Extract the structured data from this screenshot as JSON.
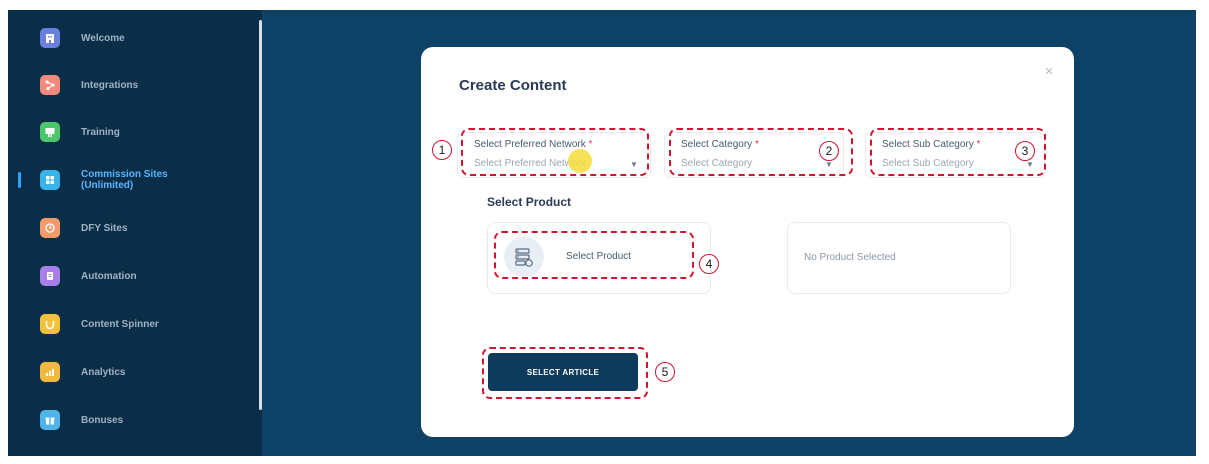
{
  "sidebar": {
    "items": [
      {
        "label": "Welcome",
        "icon": "building-icon",
        "color": "#6b7fe0",
        "active": false
      },
      {
        "label": "Integrations",
        "icon": "integrations-icon",
        "color": "#f08a7a",
        "active": false
      },
      {
        "label": "Training",
        "icon": "training-icon",
        "color": "#4cc66a",
        "active": false
      },
      {
        "label": "Commission Sites\n(Unlimited)",
        "icon": "commission-icon",
        "color": "#36b3e8",
        "active": true
      },
      {
        "label": "DFY Sites",
        "icon": "dfy-icon",
        "color": "#f59a6b",
        "active": false
      },
      {
        "label": "Automation",
        "icon": "automation-icon",
        "color": "#a77fe8",
        "active": false
      },
      {
        "label": "Content Spinner",
        "icon": "spinner-icon",
        "color": "#f4c13d",
        "active": false
      },
      {
        "label": "Analytics",
        "icon": "analytics-icon",
        "color": "#f2b941",
        "active": false
      },
      {
        "label": "Bonuses",
        "icon": "bonuses-icon",
        "color": "#4fb5e8",
        "active": false
      }
    ]
  },
  "modal": {
    "title": "Create Content",
    "close": "×",
    "fields": {
      "network": {
        "label": "Select Preferred Network",
        "required": "*",
        "value": "Select Preferred Network"
      },
      "category": {
        "label": "Select Category",
        "required": "*",
        "value": "Select Category"
      },
      "subcategory": {
        "label": "Select Sub Category",
        "required": "*",
        "value": "Select Sub Category"
      }
    },
    "product_heading": "Select Product",
    "product_button": "Select Product",
    "no_product": "No Product Selected",
    "select_article": "SELECT ARTICLE"
  },
  "annotations": [
    "1",
    "2",
    "3",
    "4",
    "5"
  ],
  "colors": {
    "background": "#0d4166",
    "sidebar": "#0b2e48",
    "annotation": "#d0162f",
    "button": "#0e3b5c",
    "required": "#e0314b"
  }
}
